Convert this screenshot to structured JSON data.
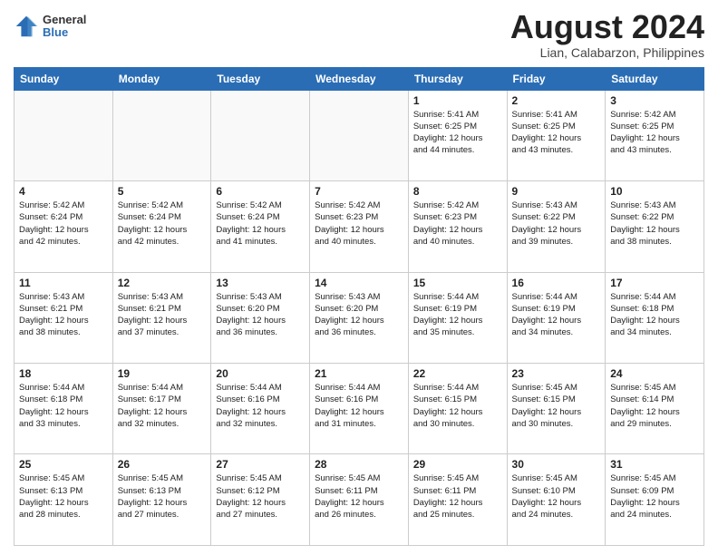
{
  "header": {
    "logo_general": "General",
    "logo_blue": "Blue",
    "month_year": "August 2024",
    "location": "Lian, Calabarzon, Philippines"
  },
  "days_of_week": [
    "Sunday",
    "Monday",
    "Tuesday",
    "Wednesday",
    "Thursday",
    "Friday",
    "Saturday"
  ],
  "weeks": [
    [
      {
        "day": "",
        "info": ""
      },
      {
        "day": "",
        "info": ""
      },
      {
        "day": "",
        "info": ""
      },
      {
        "day": "",
        "info": ""
      },
      {
        "day": "1",
        "info": "Sunrise: 5:41 AM\nSunset: 6:25 PM\nDaylight: 12 hours\nand 44 minutes."
      },
      {
        "day": "2",
        "info": "Sunrise: 5:41 AM\nSunset: 6:25 PM\nDaylight: 12 hours\nand 43 minutes."
      },
      {
        "day": "3",
        "info": "Sunrise: 5:42 AM\nSunset: 6:25 PM\nDaylight: 12 hours\nand 43 minutes."
      }
    ],
    [
      {
        "day": "4",
        "info": "Sunrise: 5:42 AM\nSunset: 6:24 PM\nDaylight: 12 hours\nand 42 minutes."
      },
      {
        "day": "5",
        "info": "Sunrise: 5:42 AM\nSunset: 6:24 PM\nDaylight: 12 hours\nand 42 minutes."
      },
      {
        "day": "6",
        "info": "Sunrise: 5:42 AM\nSunset: 6:24 PM\nDaylight: 12 hours\nand 41 minutes."
      },
      {
        "day": "7",
        "info": "Sunrise: 5:42 AM\nSunset: 6:23 PM\nDaylight: 12 hours\nand 40 minutes."
      },
      {
        "day": "8",
        "info": "Sunrise: 5:42 AM\nSunset: 6:23 PM\nDaylight: 12 hours\nand 40 minutes."
      },
      {
        "day": "9",
        "info": "Sunrise: 5:43 AM\nSunset: 6:22 PM\nDaylight: 12 hours\nand 39 minutes."
      },
      {
        "day": "10",
        "info": "Sunrise: 5:43 AM\nSunset: 6:22 PM\nDaylight: 12 hours\nand 38 minutes."
      }
    ],
    [
      {
        "day": "11",
        "info": "Sunrise: 5:43 AM\nSunset: 6:21 PM\nDaylight: 12 hours\nand 38 minutes."
      },
      {
        "day": "12",
        "info": "Sunrise: 5:43 AM\nSunset: 6:21 PM\nDaylight: 12 hours\nand 37 minutes."
      },
      {
        "day": "13",
        "info": "Sunrise: 5:43 AM\nSunset: 6:20 PM\nDaylight: 12 hours\nand 36 minutes."
      },
      {
        "day": "14",
        "info": "Sunrise: 5:43 AM\nSunset: 6:20 PM\nDaylight: 12 hours\nand 36 minutes."
      },
      {
        "day": "15",
        "info": "Sunrise: 5:44 AM\nSunset: 6:19 PM\nDaylight: 12 hours\nand 35 minutes."
      },
      {
        "day": "16",
        "info": "Sunrise: 5:44 AM\nSunset: 6:19 PM\nDaylight: 12 hours\nand 34 minutes."
      },
      {
        "day": "17",
        "info": "Sunrise: 5:44 AM\nSunset: 6:18 PM\nDaylight: 12 hours\nand 34 minutes."
      }
    ],
    [
      {
        "day": "18",
        "info": "Sunrise: 5:44 AM\nSunset: 6:18 PM\nDaylight: 12 hours\nand 33 minutes."
      },
      {
        "day": "19",
        "info": "Sunrise: 5:44 AM\nSunset: 6:17 PM\nDaylight: 12 hours\nand 32 minutes."
      },
      {
        "day": "20",
        "info": "Sunrise: 5:44 AM\nSunset: 6:16 PM\nDaylight: 12 hours\nand 32 minutes."
      },
      {
        "day": "21",
        "info": "Sunrise: 5:44 AM\nSunset: 6:16 PM\nDaylight: 12 hours\nand 31 minutes."
      },
      {
        "day": "22",
        "info": "Sunrise: 5:44 AM\nSunset: 6:15 PM\nDaylight: 12 hours\nand 30 minutes."
      },
      {
        "day": "23",
        "info": "Sunrise: 5:45 AM\nSunset: 6:15 PM\nDaylight: 12 hours\nand 30 minutes."
      },
      {
        "day": "24",
        "info": "Sunrise: 5:45 AM\nSunset: 6:14 PM\nDaylight: 12 hours\nand 29 minutes."
      }
    ],
    [
      {
        "day": "25",
        "info": "Sunrise: 5:45 AM\nSunset: 6:13 PM\nDaylight: 12 hours\nand 28 minutes."
      },
      {
        "day": "26",
        "info": "Sunrise: 5:45 AM\nSunset: 6:13 PM\nDaylight: 12 hours\nand 27 minutes."
      },
      {
        "day": "27",
        "info": "Sunrise: 5:45 AM\nSunset: 6:12 PM\nDaylight: 12 hours\nand 27 minutes."
      },
      {
        "day": "28",
        "info": "Sunrise: 5:45 AM\nSunset: 6:11 PM\nDaylight: 12 hours\nand 26 minutes."
      },
      {
        "day": "29",
        "info": "Sunrise: 5:45 AM\nSunset: 6:11 PM\nDaylight: 12 hours\nand 25 minutes."
      },
      {
        "day": "30",
        "info": "Sunrise: 5:45 AM\nSunset: 6:10 PM\nDaylight: 12 hours\nand 24 minutes."
      },
      {
        "day": "31",
        "info": "Sunrise: 5:45 AM\nSunset: 6:09 PM\nDaylight: 12 hours\nand 24 minutes."
      }
    ]
  ]
}
